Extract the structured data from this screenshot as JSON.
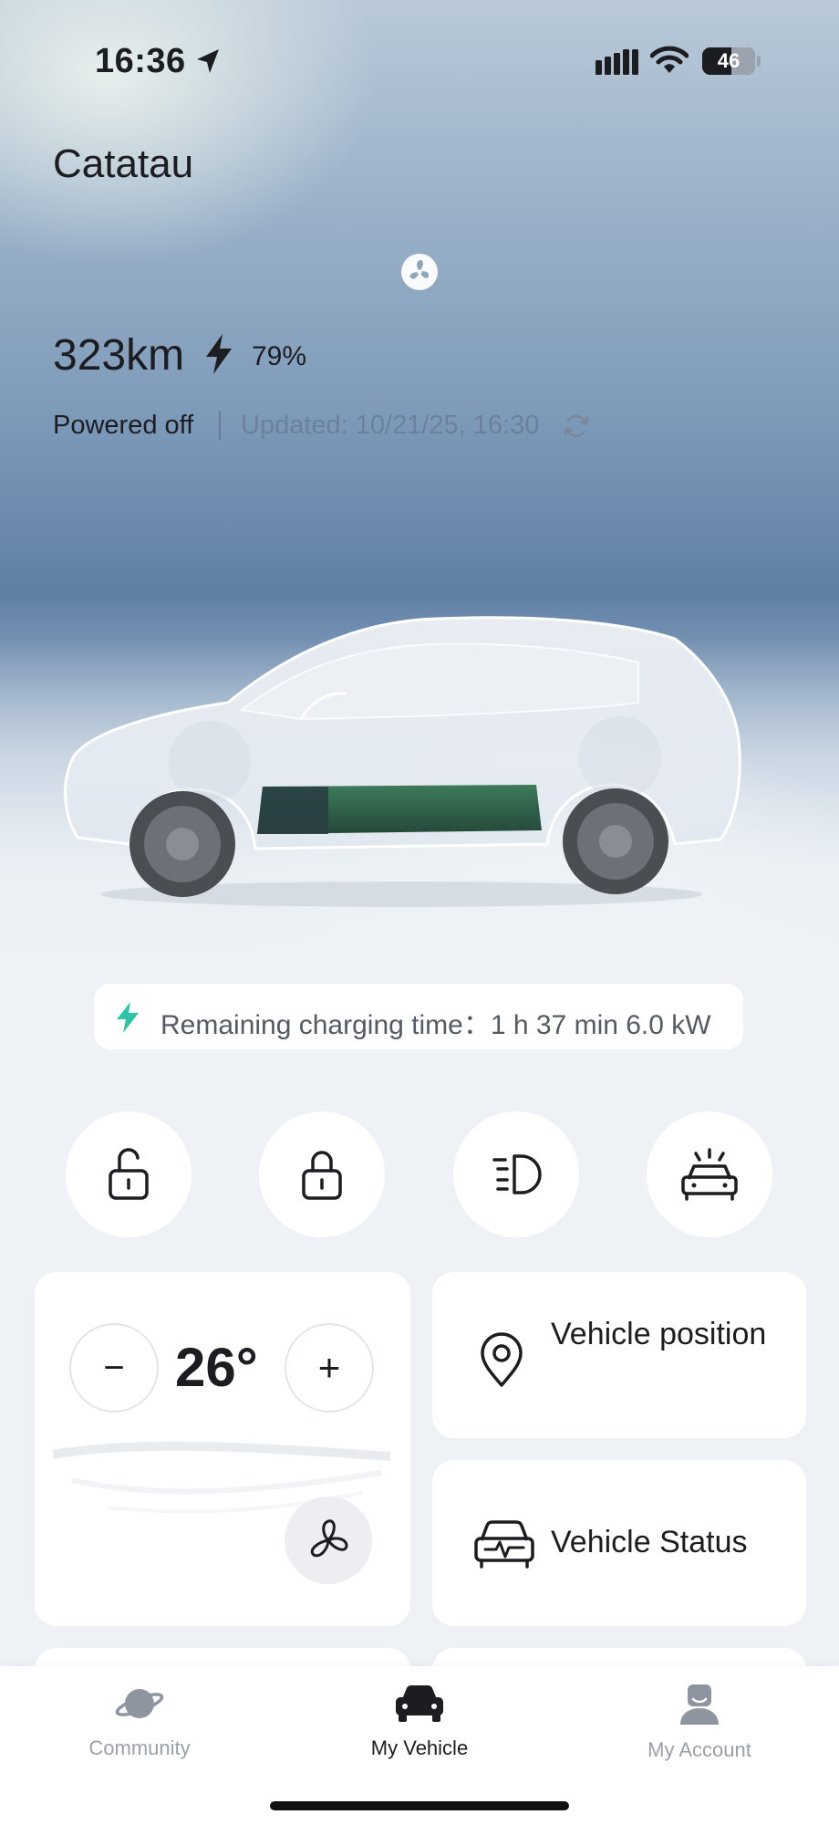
{
  "status_bar": {
    "time": "16:36",
    "battery_level": "46",
    "icons": [
      "location-arrow-icon",
      "cellular-signal-icon",
      "wifi-icon",
      "battery-icon"
    ]
  },
  "vehicle": {
    "name": "Catatau",
    "range": "323km",
    "battery_percent": "79%",
    "power_state": "Powered off",
    "updated": "Updated: 10/21/25, 16:30"
  },
  "charging": {
    "text": "Remaining charging time：1 h 37 min 6.0 kW",
    "accent_color": "#2fc3a5"
  },
  "quick_actions": [
    {
      "name": "unlock",
      "icon": "unlocked-padlock-icon"
    },
    {
      "name": "lock",
      "icon": "padlock-icon"
    },
    {
      "name": "headlights",
      "icon": "headlight-icon"
    },
    {
      "name": "find-car",
      "icon": "car-alert-icon"
    }
  ],
  "climate": {
    "temperature": "26°",
    "decrease_symbol": "−",
    "increase_symbol": "+"
  },
  "cards": {
    "position_label": "Vehicle position",
    "status_label": "Vehicle Status"
  },
  "tabs": [
    {
      "label": "Community",
      "icon": "planet-icon",
      "active": false
    },
    {
      "label": "My Vehicle",
      "icon": "car-icon",
      "active": true
    },
    {
      "label": "My Account",
      "icon": "user-icon",
      "active": false
    }
  ],
  "colors": {
    "battery_pack": "#2f5e45",
    "text_primary": "#1c1d21",
    "text_muted": "#9aa0a8"
  }
}
